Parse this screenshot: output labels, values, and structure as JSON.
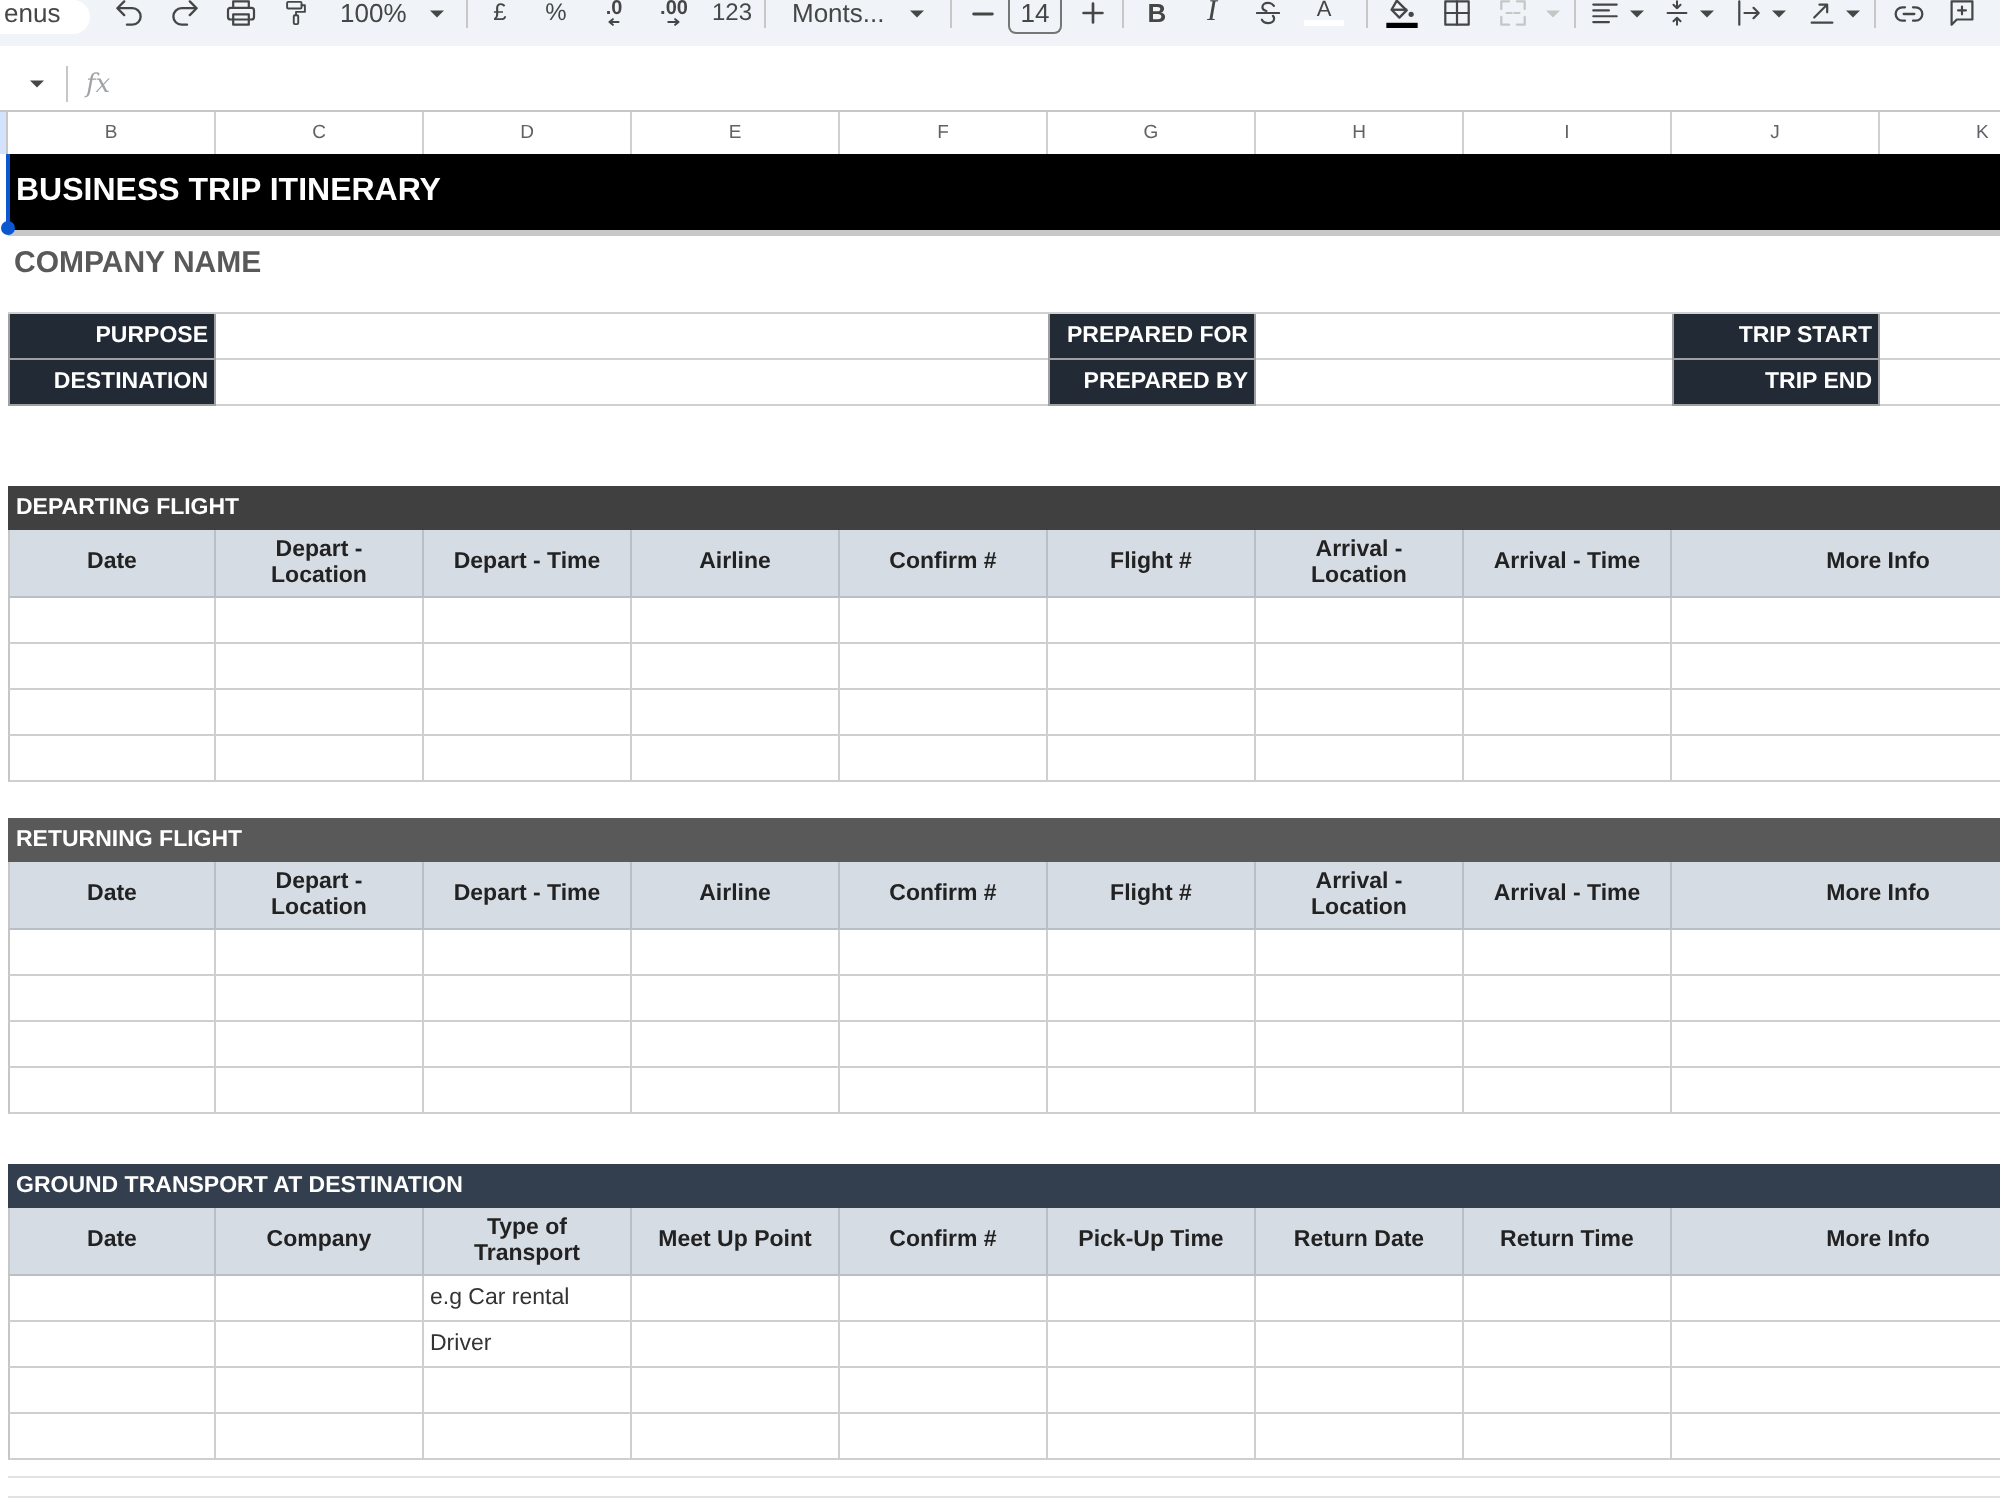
{
  "toolbar": {
    "menus": "enus",
    "zoom": "100%",
    "currency": "£",
    "percent": "%",
    "decrease_decimals": ".0",
    "increase_decimals": ".00",
    "number_format": "123",
    "font": "Monts...",
    "font_size": "14",
    "bold": "B",
    "italic": "I",
    "text_color": "A",
    "merge": {
      "disabled": true
    }
  },
  "formula_bar": {
    "fx": "fx"
  },
  "column_headers": [
    "B",
    "C",
    "D",
    "E",
    "F",
    "G",
    "H",
    "I",
    "J",
    "K"
  ],
  "sheet": {
    "title": "BUSINESS TRIP ITINERARY",
    "selection_handle": true,
    "company": "COMPANY NAME",
    "info_rows": [
      [
        "PURPOSE",
        "PREPARED FOR",
        "TRIP START"
      ],
      [
        "DESTINATION",
        "PREPARED BY",
        "TRIP END"
      ]
    ],
    "sections": [
      {
        "title": "DEPARTING FLIGHT",
        "color": "#404040",
        "columns": [
          "Date",
          "Depart - Location",
          "Depart - Time",
          "Airline",
          "Confirm #",
          "Flight #",
          "Arrival - Location",
          "Arrival - Time",
          "More Info"
        ],
        "rows": [
          [
            null,
            null,
            null,
            null,
            null,
            null,
            null,
            null,
            null
          ],
          [
            null,
            null,
            null,
            null,
            null,
            null,
            null,
            null,
            null
          ],
          [
            null,
            null,
            null,
            null,
            null,
            null,
            null,
            null,
            null
          ],
          [
            null,
            null,
            null,
            null,
            null,
            null,
            null,
            null,
            null
          ]
        ]
      },
      {
        "title": "RETURNING FLIGHT",
        "color": "#595959",
        "columns": [
          "Date",
          "Depart - Location",
          "Depart - Time",
          "Airline",
          "Confirm #",
          "Flight #",
          "Arrival - Location",
          "Arrival - Time",
          "More Info"
        ],
        "rows": [
          [
            null,
            null,
            null,
            null,
            null,
            null,
            null,
            null,
            null
          ],
          [
            null,
            null,
            null,
            null,
            null,
            null,
            null,
            null,
            null
          ],
          [
            null,
            null,
            null,
            null,
            null,
            null,
            null,
            null,
            null
          ],
          [
            null,
            null,
            null,
            null,
            null,
            null,
            null,
            null,
            null
          ]
        ]
      },
      {
        "title": "GROUND TRANSPORT AT DESTINATION",
        "color": "#333f4f",
        "columns": [
          "Date",
          "Company",
          "Type of Transport",
          "Meet Up Point",
          "Confirm #",
          "Pick-Up Time",
          "Return Date",
          "Return Time",
          "More Info"
        ],
        "rows": [
          [
            null,
            null,
            "e.g Car rental",
            null,
            null,
            null,
            null,
            null,
            null
          ],
          [
            null,
            null,
            "Driver",
            null,
            null,
            null,
            null,
            null,
            null
          ],
          [
            null,
            null,
            null,
            null,
            null,
            null,
            null,
            null,
            null
          ],
          [
            null,
            null,
            null,
            null,
            null,
            null,
            null,
            null,
            null
          ]
        ]
      }
    ]
  }
}
